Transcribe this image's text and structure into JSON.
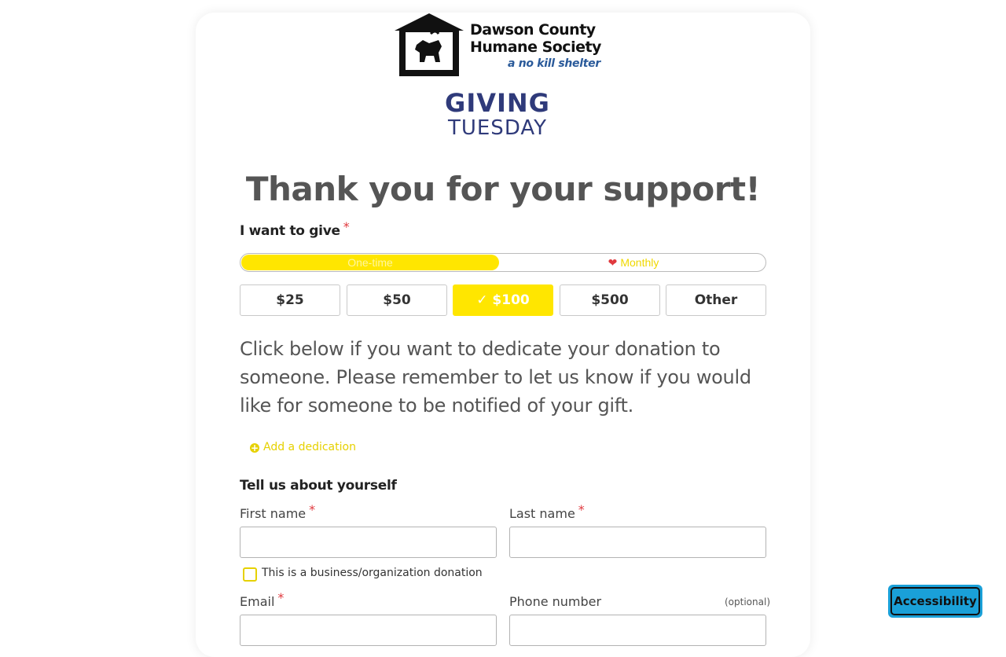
{
  "org": {
    "name_line1": "Dawson County",
    "name_line2": "Humane Society",
    "tagline": "a no kill shelter",
    "campaign_line1": "GIVING",
    "campaign_line2": "TUESDAY"
  },
  "headline": "Thank you for your support!",
  "give": {
    "label": "I want to give",
    "required_mark": "*",
    "frequency": {
      "one_time": "One-time",
      "monthly": "Monthly",
      "selected": "One-time"
    },
    "amounts": [
      "$25",
      "$50",
      "$100",
      "$500",
      "Other"
    ],
    "selected_amount": "$100"
  },
  "dedication": {
    "text": "Click below if you want to dedicate your donation to someone.  Please remember to let us know if you would like for someone to be notified of your gift.",
    "add_link": "Add a dedication"
  },
  "about": {
    "title": "Tell us about yourself",
    "first_name_label": "First name",
    "last_name_label": "Last name",
    "first_name_value": "",
    "last_name_value": "",
    "business_checkbox_label": "This is a business/organization donation",
    "email_label": "Email",
    "phone_label": "Phone number",
    "phone_optional": "(optional)"
  },
  "accessibility_button": "Accessibility",
  "colors": {
    "accent": "#ffe600",
    "required": "#e0393e",
    "accessibility_bg": "#1aa0d8",
    "campaign_blue": "#2f3a7a"
  }
}
